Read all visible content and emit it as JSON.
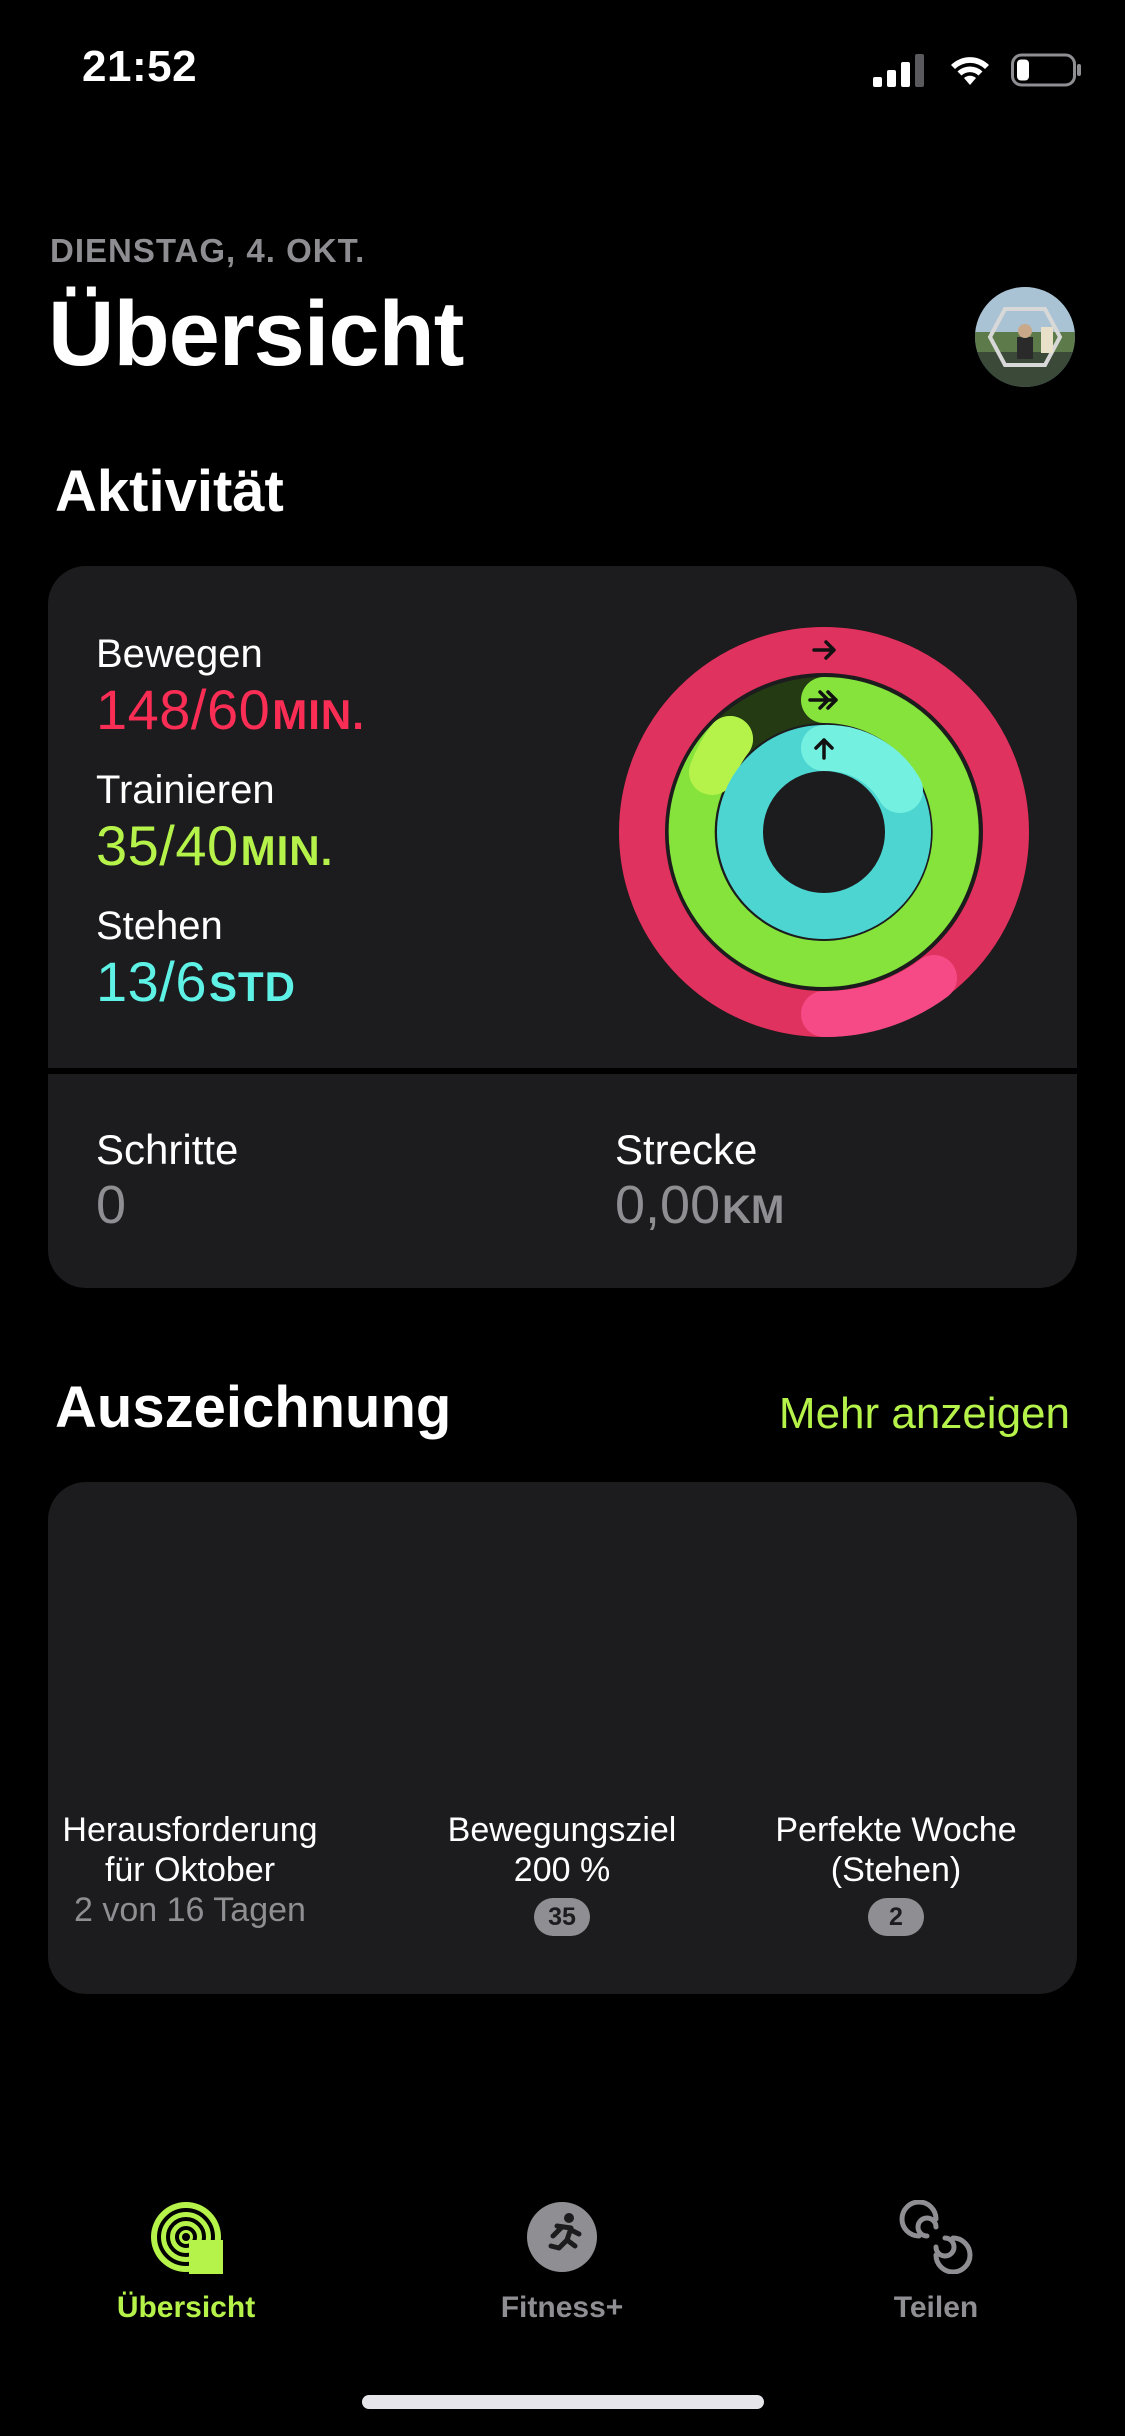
{
  "status_bar": {
    "time": "21:52"
  },
  "header": {
    "date": "DIENSTAG, 4. OKT.",
    "title": "Übersicht"
  },
  "activity": {
    "section_title": "Aktivität",
    "move": {
      "label": "Bewegen",
      "value": "148/60",
      "unit": "MIN.",
      "color": "#fa2d55",
      "progress": 2.47
    },
    "exercise": {
      "label": "Trainieren",
      "value": "35/40",
      "unit": "MIN.",
      "color": "#b6f34a",
      "progress": 0.875
    },
    "stand": {
      "label": "Stehen",
      "value": "13/6",
      "unit": "STD",
      "color": "#5ef1e5",
      "progress": 2.17
    },
    "steps": {
      "label": "Schritte",
      "value": "0"
    },
    "distance": {
      "label": "Strecke",
      "value": "0,00",
      "unit": "KM"
    }
  },
  "awards": {
    "section_title": "Auszeichnung",
    "more_link": "Mehr anzeigen",
    "items": [
      {
        "line1": "Herausforderung",
        "line2": "für Oktober",
        "sub": "2 von 16 Tagen"
      },
      {
        "line1": "Bewegungsziel",
        "line2": "200 %",
        "badge": "35"
      },
      {
        "line1": "Perfekte Woche",
        "line2": "(Stehen)",
        "badge": "2"
      }
    ]
  },
  "tab_bar": {
    "items": [
      {
        "label": "Übersicht",
        "icon": "activity-rings-icon",
        "active": true
      },
      {
        "label": "Fitness+",
        "icon": "runner-icon",
        "active": false
      },
      {
        "label": "Teilen",
        "icon": "sharing-icon",
        "active": false
      }
    ]
  },
  "colors": {
    "accent": "#b6f34a",
    "move": "#fa2d55",
    "exercise": "#b6f34a",
    "stand": "#5ef1e5",
    "card": "#1c1c1e",
    "secondary_text": "#8e8e93"
  }
}
